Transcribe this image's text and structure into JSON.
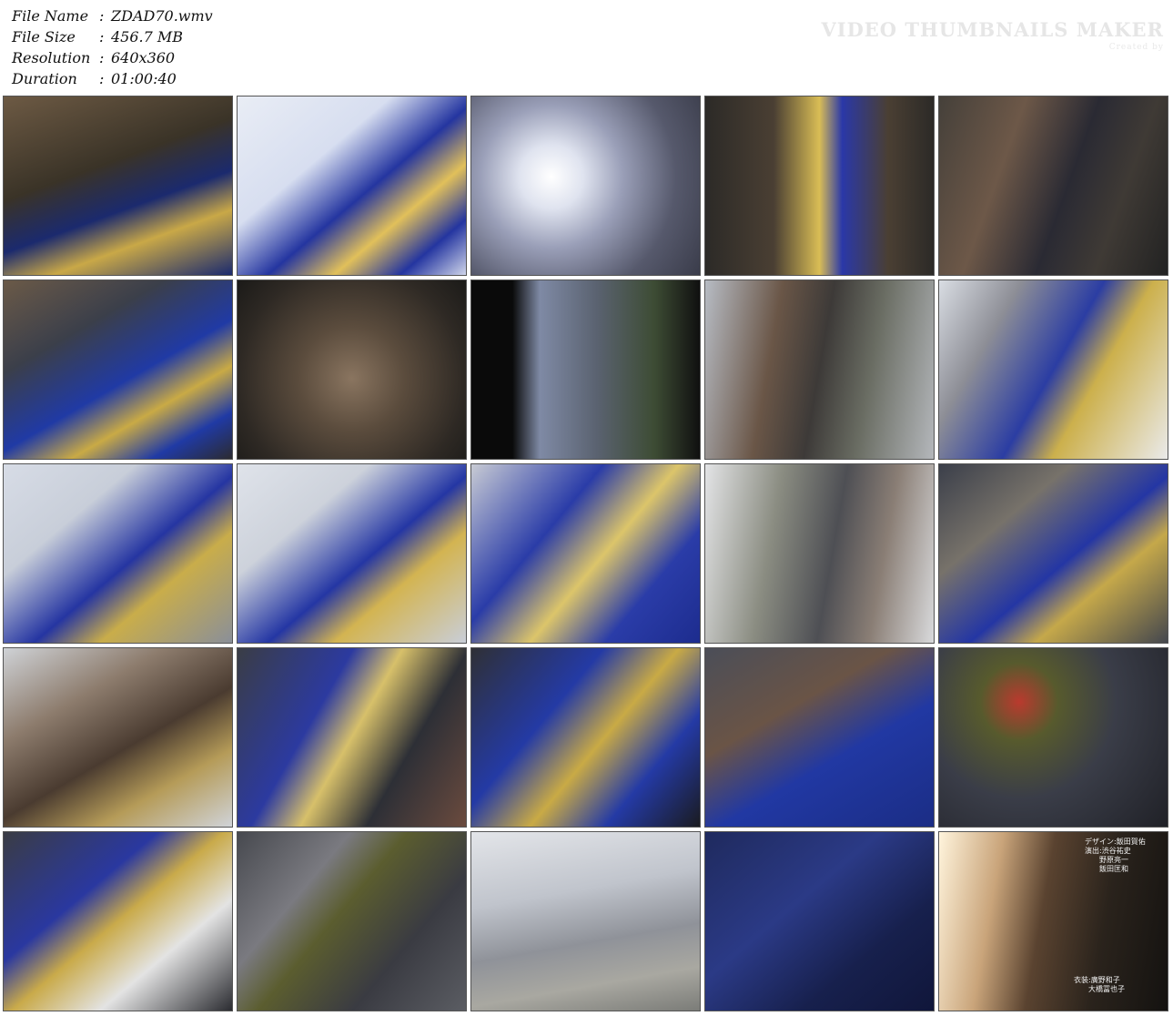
{
  "info": [
    {
      "label": "File Name",
      "sep": ":",
      "value": "ZDAD70.wmv"
    },
    {
      "label": "File Size",
      "sep": ":",
      "value": "456.7 MB"
    },
    {
      "label": "Resolution",
      "sep": ":",
      "value": "640x360"
    },
    {
      "label": "Duration",
      "sep": ":",
      "value": "01:00:40"
    }
  ],
  "watermark": {
    "title": "VIDEO THUMBNAILS MAKER",
    "sub": "Created by"
  },
  "thumbs": [
    {
      "bg": "linear-gradient(160deg,#6d5a44 0%,#3a3327 40%,#1b2a6e 60%,#c9a847 75%,#1b2a6e 100%)"
    },
    {
      "bg": "linear-gradient(140deg,#e9edf5 0%,#d7def0 35%,#2435a0 55%,#e1c05a 70%,#2435a0 85%,#cfd5ea 100%)"
    },
    {
      "bg": "radial-gradient(circle at 35% 45%,#ffffff 0%,#dfe3ef 18%,#9a9fb8 40%,#56596c 70%,#3a3c4a 100%)"
    },
    {
      "bg": "linear-gradient(90deg,#2c2a27 0%,#4a3f33 30%,#d9bd55 50%,#2a38a8 60%,#4a3f33 80%,#2c2a27 100%)"
    },
    {
      "bg": "linear-gradient(110deg,#45403a 0%,#6d5848 30%,#2a2a33 55%,#3f3a35 75%,#222 100%)"
    },
    {
      "bg": "linear-gradient(150deg,#6b5a48 0%,#3b3f4a 30%,#203aa5 55%,#c9aa45 70%,#203aa5 85%,#2b2b30 100%)"
    },
    {
      "bg": "radial-gradient(circle at 50% 55%,#8a7560 0%,#5b4c3d 35%,#2e2924 75%,#1b1a18 100%)"
    },
    {
      "bg": "linear-gradient(90deg,#0a0a0a 0%,#0a0a0a 18%,#7f8aa5 30%,#5a6270 55%,#3d4c34 80%,#101010 100%)"
    },
    {
      "bg": "linear-gradient(100deg,#b7bcc4 0%,#6a5647 30%,#3d3a38 50%,#6a6d63 70%,#b4b7bb 100%)"
    },
    {
      "bg": "linear-gradient(120deg,#d9dde3 0%,#8d8e96 25%,#2b3da3 50%,#ccb04c 65%,#eaeaea 100%)"
    },
    {
      "bg": "linear-gradient(140deg,#d7dce6 0%,#c8ced9 30%,#2535a2 55%,#c9ad4a 70%,#8a8f99 100%)"
    },
    {
      "bg": "linear-gradient(140deg,#dfe3ea 0%,#cdd2db 30%,#2436a4 55%,#d3b451 70%,#c9ced8 100%)"
    },
    {
      "bg": "linear-gradient(130deg,#c8cbd4 0%,#2a3ca8 35%,#dcc56a 55%,#2a3ca8 75%,#1d2c8e 100%)"
    },
    {
      "bg": "linear-gradient(100deg,#e3e4e6 0%,#8b8d82 30%,#4e4f54 55%,#8a7e75 75%,#d9dadc 100%)"
    },
    {
      "bg": "linear-gradient(140deg,#3b3f4a 0%,#77726a 30%,#2436a4 55%,#c5a84a 70%,#44474e 100%)"
    },
    {
      "bg": "linear-gradient(150deg,#cfd2d6 0%,#8d7c6d 30%,#4a3b30 55%,#b59b58 75%,#d0d3d8 100%)"
    },
    {
      "bg": "linear-gradient(120deg,#3a3d45 0%,#2c3aa0 35%,#d7c06a 50%,#2d2f36 70%,#6b4b3e 100%)"
    },
    {
      "bg": "linear-gradient(130deg,#2f3035 0%,#243aa5 35%,#c9aa45 55%,#243aa5 75%,#1a1b20 100%)"
    },
    {
      "bg": "linear-gradient(150deg,#4b4e58 0%,#6a5446 35%,#2138a3 60%,#1b2d85 100%)"
    },
    {
      "bg": "radial-gradient(circle at 35% 30%,#ba3a2e 0%,#575a2d 20%,#3a3d48 50%,#202127 100%)"
    },
    {
      "bg": "linear-gradient(140deg,#3a3c44 0%,#2a38a0 35%,#c9aa4a 50%,#e3e3e3 70%,#2b2c31 100%)"
    },
    {
      "bg": "linear-gradient(130deg,#47494f 0%,#7a7a80 30%,#5b5d2f 45%,#3a3b42 70%,#5b5d63 100%)"
    },
    {
      "bg": "linear-gradient(170deg,#e3e5e9 0%,#c0c4cc 35%,#8f9299 60%,#a9a8a1 80%,#7b7c78 100%)"
    },
    {
      "bg": "linear-gradient(140deg,#1f2a5e 0%,#2b3a86 40%,#17204d 70%,#10163a 100%)"
    },
    {
      "bg": "linear-gradient(100deg,#fff4dc 0%,#c9a47a 25%,#5a4330 45%,#2a231c 70%,#141210 100%)"
    }
  ],
  "credits_1": "デザイン:飯田賀佑\n演出:渋谷祐史\n　　野原亮一\n　　飯田匡和",
  "credits_2": "衣装:廣野和子\n　　大橋冨也子"
}
